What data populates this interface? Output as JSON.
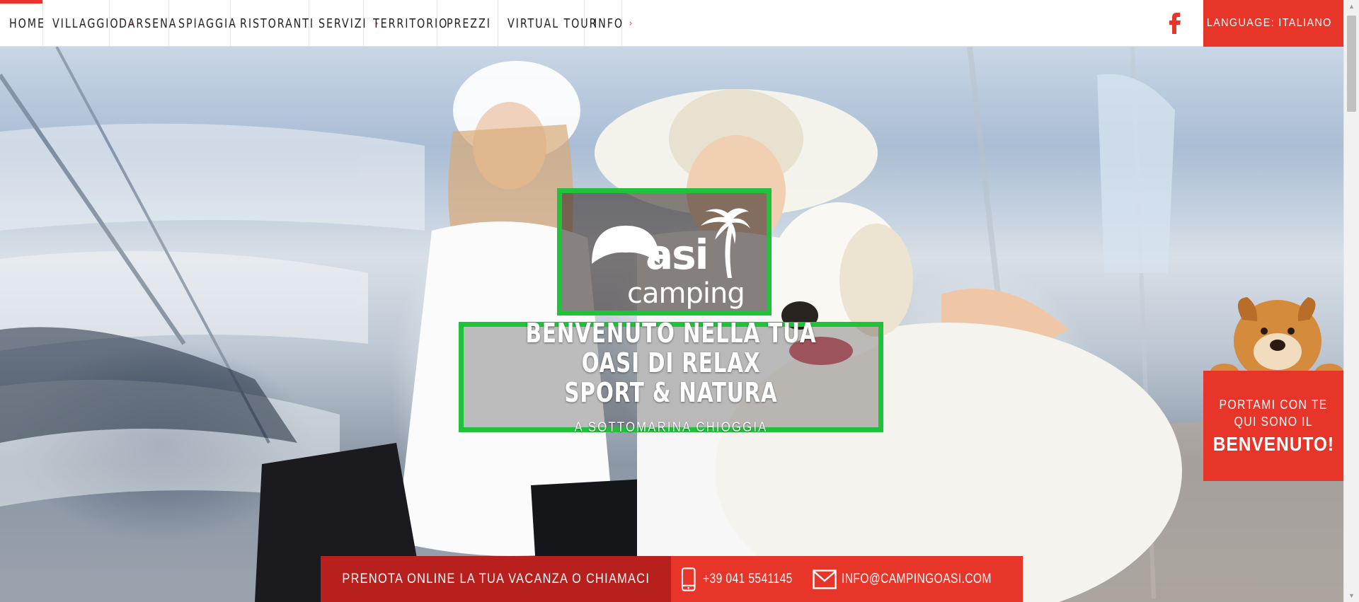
{
  "nav": {
    "items": [
      {
        "label": "HOME",
        "active": true,
        "has_submenu": false
      },
      {
        "label": "VILLAGGIO",
        "active": false,
        "has_submenu": true
      },
      {
        "label": "DARSENA",
        "active": false,
        "has_submenu": false
      },
      {
        "label": "SPIAGGIA",
        "active": false,
        "has_submenu": false
      },
      {
        "label": "RISTORANTI",
        "active": false,
        "has_submenu": false
      },
      {
        "label": "SERVIZI",
        "active": false,
        "has_submenu": true
      },
      {
        "label": "TERRITORIO",
        "active": false,
        "has_submenu": false
      },
      {
        "label": "PREZZI",
        "active": false,
        "has_submenu": false
      },
      {
        "label": "VIRTUAL TOUR",
        "active": false,
        "has_submenu": false
      },
      {
        "label": "INFO",
        "active": false,
        "has_submenu": true
      }
    ],
    "submenu_indicator": "›",
    "facebook_icon": "f",
    "language_label": "LANGUAGE: ITALIANO",
    "language_arrow": "›"
  },
  "hero": {
    "logo": {
      "word": "asi",
      "sub": "camping"
    },
    "headline_line1": "BENVENUTO NELLA TUA OASI DI RELAX",
    "headline_line2": "SPORT & NATURA",
    "subheadline": "A SOTTOMARINA CHIOGGIA",
    "highlight_color": "#1fc23a"
  },
  "dog_promo": {
    "line1": "PORTAMI CON TE",
    "line2": "QUI SONO IL",
    "line3": "BENVENUTO!"
  },
  "booking": {
    "cta": "PRENOTA ONLINE LA TUA VACANZA O CHIAMACI",
    "phone": "+39 041 5541145",
    "email": "INFO@CAMPINGOASI.COM"
  },
  "colors": {
    "accent": "#e8352a",
    "accent_dark": "#b8201d"
  }
}
